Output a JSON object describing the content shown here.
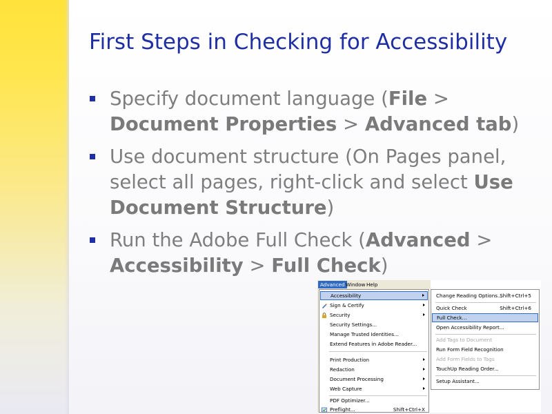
{
  "slide": {
    "title": "First Steps in Checking for Accessibility",
    "bullets": [
      {
        "parts": [
          {
            "text": "Specify document language (",
            "bold": false
          },
          {
            "text": "File",
            "bold": true
          },
          {
            "text": " > ",
            "bold": false
          },
          {
            "text": "Document Properties",
            "bold": true
          },
          {
            "text": " > ",
            "bold": false
          },
          {
            "text": "Advanced tab",
            "bold": true
          },
          {
            "text": ")",
            "bold": false
          }
        ]
      },
      {
        "parts": [
          {
            "text": "Use document structure (On Pages panel, select all pages, right-click and select ",
            "bold": false
          },
          {
            "text": "Use Document Structure",
            "bold": true
          },
          {
            "text": ")",
            "bold": false
          }
        ]
      },
      {
        "parts": [
          {
            "text": "Run the Adobe Full Check (",
            "bold": false
          },
          {
            "text": "Advanced",
            "bold": true
          },
          {
            "text": " > ",
            "bold": false
          },
          {
            "text": "Accessibility",
            "bold": true
          },
          {
            "text": " > ",
            "bold": false
          },
          {
            "text": "Full Check",
            "bold": true
          },
          {
            "text": ")",
            "bold": false
          }
        ]
      }
    ]
  },
  "menu_screenshot": {
    "menubar": [
      "Advanced",
      "Window",
      "Help"
    ],
    "main_menu": [
      {
        "label": "Accessibility",
        "shortcut": "",
        "submenu": true,
        "highlight": true,
        "icon": ""
      },
      {
        "label": "Sign & Certify",
        "shortcut": "",
        "submenu": true,
        "highlight": false,
        "icon": "pen-icon"
      },
      {
        "label": "Security",
        "shortcut": "",
        "submenu": true,
        "highlight": false,
        "icon": "lock-icon"
      },
      {
        "label": "Security Settings...",
        "shortcut": "",
        "submenu": false,
        "highlight": false,
        "icon": ""
      },
      {
        "label": "Manage Trusted Identities...",
        "shortcut": "",
        "submenu": false,
        "highlight": false,
        "icon": ""
      },
      {
        "label": "Extend Features in Adobe Reader...",
        "shortcut": "",
        "submenu": false,
        "highlight": false,
        "icon": ""
      },
      {
        "label": "Print Production",
        "shortcut": "",
        "submenu": true,
        "highlight": false,
        "icon": ""
      },
      {
        "label": "Redaction",
        "shortcut": "",
        "submenu": true,
        "highlight": false,
        "icon": ""
      },
      {
        "label": "Document Processing",
        "shortcut": "",
        "submenu": true,
        "highlight": false,
        "icon": ""
      },
      {
        "label": "Web Capture",
        "shortcut": "",
        "submenu": true,
        "highlight": false,
        "icon": ""
      },
      {
        "label": "PDF Optimizer...",
        "shortcut": "",
        "submenu": false,
        "highlight": false,
        "icon": ""
      },
      {
        "label": "Preflight...",
        "shortcut": "Shift+Ctrl+X",
        "submenu": false,
        "highlight": false,
        "icon": "preflight-icon"
      }
    ],
    "submenu": [
      {
        "label": "Change Reading Options...",
        "shortcut": "Shift+Ctrl+5",
        "disabled": false,
        "highlight": false
      },
      {
        "label": "Quick Check",
        "shortcut": "Shift+Ctrl+6",
        "disabled": false,
        "highlight": false
      },
      {
        "label": "Full Check...",
        "shortcut": "",
        "disabled": false,
        "highlight": true
      },
      {
        "label": "Open Accessibility Report...",
        "shortcut": "",
        "disabled": false,
        "highlight": false
      },
      {
        "label": "Add Tags to Document",
        "shortcut": "",
        "disabled": true,
        "highlight": false
      },
      {
        "label": "Run Form Field Recognition",
        "shortcut": "",
        "disabled": false,
        "highlight": false
      },
      {
        "label": "Add Form Fields to Tags",
        "shortcut": "",
        "disabled": true,
        "highlight": false
      },
      {
        "label": "TouchUp Reading Order...",
        "shortcut": "",
        "disabled": false,
        "highlight": false
      },
      {
        "label": "Setup Assistant...",
        "shortcut": "",
        "disabled": false,
        "highlight": false
      }
    ],
    "colors": {
      "highlight_bg": "#c1d2ee",
      "highlight_border": "#316ac5",
      "menubar_active": "#316ac5"
    }
  }
}
